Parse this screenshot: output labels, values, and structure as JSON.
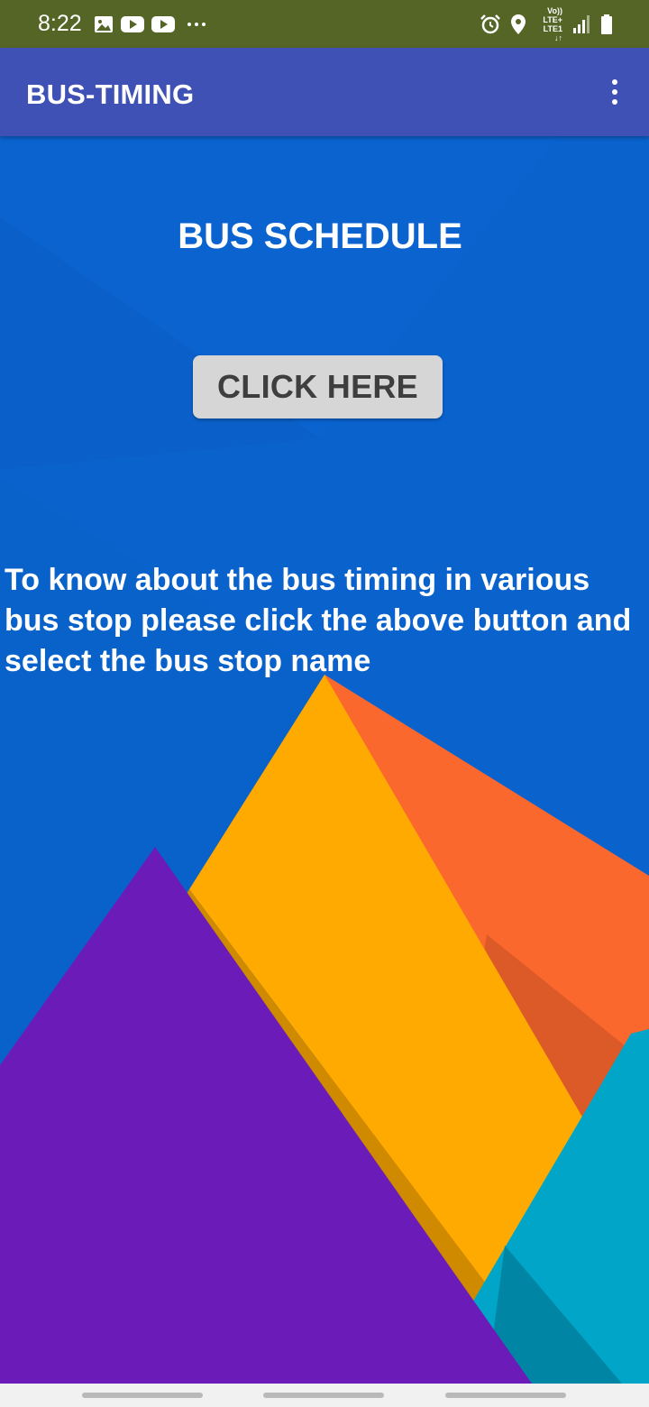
{
  "status_bar": {
    "time": "8:22",
    "network_line1": "Vo)) LTE+",
    "network_line2": "LTE1 ↓↑",
    "icons": [
      "image-icon",
      "youtube-icon",
      "youtube-icon",
      "more-dots-icon",
      "alarm-icon",
      "location-icon",
      "signal-icon",
      "battery-icon"
    ]
  },
  "app_bar": {
    "title": "BUS-TIMING",
    "overflow_icon": "more-vert-icon"
  },
  "main": {
    "heading": "BUS SCHEDULE",
    "button_label": "CLICK HERE",
    "description": "To know about the bus timing in various bus stop please click the above button and select the bus stop name"
  },
  "colors": {
    "status_bar": "#556526",
    "app_bar": "#3f51b5",
    "background_blue": "#0a63cf",
    "button": "#d6d6d6",
    "wallpaper_orange": "#fb682e",
    "wallpaper_yellow": "#ffaa00",
    "wallpaper_purple": "#6b1cb8",
    "wallpaper_teal": "#00a5c8"
  }
}
